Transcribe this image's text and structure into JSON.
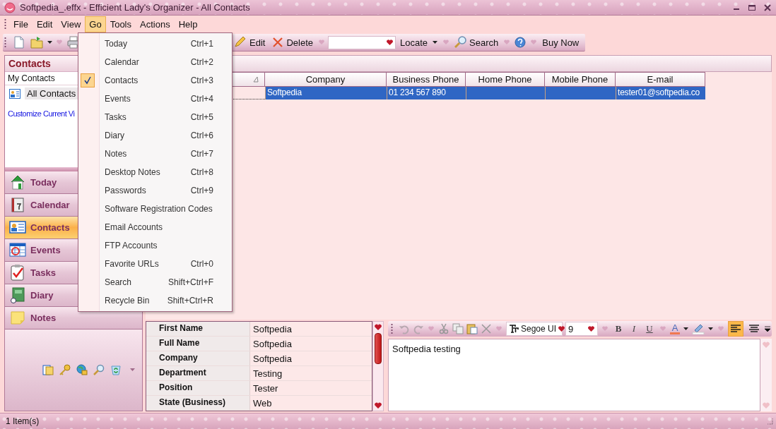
{
  "window": {
    "title": "Softpedia_.effx - Efficient Lady's Organizer - All Contacts"
  },
  "menu_bar": [
    {
      "label": "File",
      "selected": false
    },
    {
      "label": "Edit",
      "selected": false
    },
    {
      "label": "View",
      "selected": false
    },
    {
      "label": "Go",
      "selected": true
    },
    {
      "label": "Tools",
      "selected": false
    },
    {
      "label": "Actions",
      "selected": false
    },
    {
      "label": "Help",
      "selected": false
    }
  ],
  "go_menu": [
    {
      "label": "Today",
      "shortcut": "Ctrl+1",
      "checked": false
    },
    {
      "label": "Calendar",
      "shortcut": "Ctrl+2",
      "checked": false
    },
    {
      "label": "Contacts",
      "shortcut": "Ctrl+3",
      "checked": true
    },
    {
      "label": "Events",
      "shortcut": "Ctrl+4",
      "checked": false
    },
    {
      "label": "Tasks",
      "shortcut": "Ctrl+5",
      "checked": false
    },
    {
      "label": "Diary",
      "shortcut": "Ctrl+6",
      "checked": false
    },
    {
      "label": "Notes",
      "shortcut": "Ctrl+7",
      "checked": false
    },
    {
      "label": "Desktop Notes",
      "shortcut": "Ctrl+8",
      "checked": false
    },
    {
      "label": "Passwords",
      "shortcut": "Ctrl+9",
      "checked": false
    },
    {
      "label": "Software Registration Codes",
      "checked": false
    },
    {
      "label": "Email Accounts",
      "checked": false
    },
    {
      "label": "FTP Accounts",
      "checked": false
    },
    {
      "label": "Favorite URLs",
      "shortcut": "Ctrl+0",
      "checked": false
    },
    {
      "label": "Search",
      "shortcut": "Shift+Ctrl+F",
      "checked": false
    },
    {
      "label": "Recycle Bin",
      "shortcut": "Shift+Ctrl+R",
      "checked": false
    }
  ],
  "toolbar": {
    "buttons": [
      "Edit",
      "Delete",
      "Locate",
      "Search",
      "Buy Now"
    ]
  },
  "sidebar": {
    "header": "Contacts",
    "group_label": "My Contacts",
    "items": [
      {
        "label": "All Contacts",
        "selected": true
      }
    ],
    "customize_link": "Customize Current Vi",
    "nav_buttons": [
      {
        "label": "Today",
        "selected": false
      },
      {
        "label": "Calendar",
        "selected": false
      },
      {
        "label": "Contacts",
        "selected": true
      },
      {
        "label": "Events",
        "selected": false
      },
      {
        "label": "Tasks",
        "selected": false
      },
      {
        "label": "Diary",
        "selected": false
      },
      {
        "label": "Notes",
        "selected": false
      }
    ]
  },
  "table": {
    "first_column_sorted": true,
    "columns": [
      {
        "label": "Company"
      },
      {
        "label": "Business Phone"
      },
      {
        "label": "Home Phone"
      },
      {
        "label": "Mobile Phone"
      },
      {
        "label": "E-mail"
      }
    ],
    "rows": [
      {
        "selected": true,
        "cells": [
          "Softpedia",
          "01 234 567 890",
          null,
          null,
          "tester01@softpedia.co"
        ]
      }
    ]
  },
  "details": [
    {
      "label": "First Name",
      "value": "Softpedia"
    },
    {
      "label": "Full Name",
      "value": "Softpedia"
    },
    {
      "label": "Company",
      "value": "Softpedia"
    },
    {
      "label": "Department",
      "value": "Testing"
    },
    {
      "label": "Position",
      "value": "Tester"
    },
    {
      "label": "State (Business)",
      "value": "Web"
    }
  ],
  "notes_editor": {
    "undo_disabled": true,
    "redo_disabled": true,
    "font": "Segoe UI",
    "size": "9",
    "format_buttons": [
      {
        "kind": "bold",
        "label": "B"
      },
      {
        "kind": "italic",
        "label": "I"
      },
      {
        "kind": "underline",
        "label": "U"
      },
      {
        "kind": "color",
        "label": "A"
      }
    ],
    "align_buttons": [
      {
        "kind": "left",
        "selected": true
      },
      {
        "kind": "center",
        "selected": false
      }
    ],
    "text": "Softpedia testing"
  },
  "status_bar": "1 Item(s)"
}
